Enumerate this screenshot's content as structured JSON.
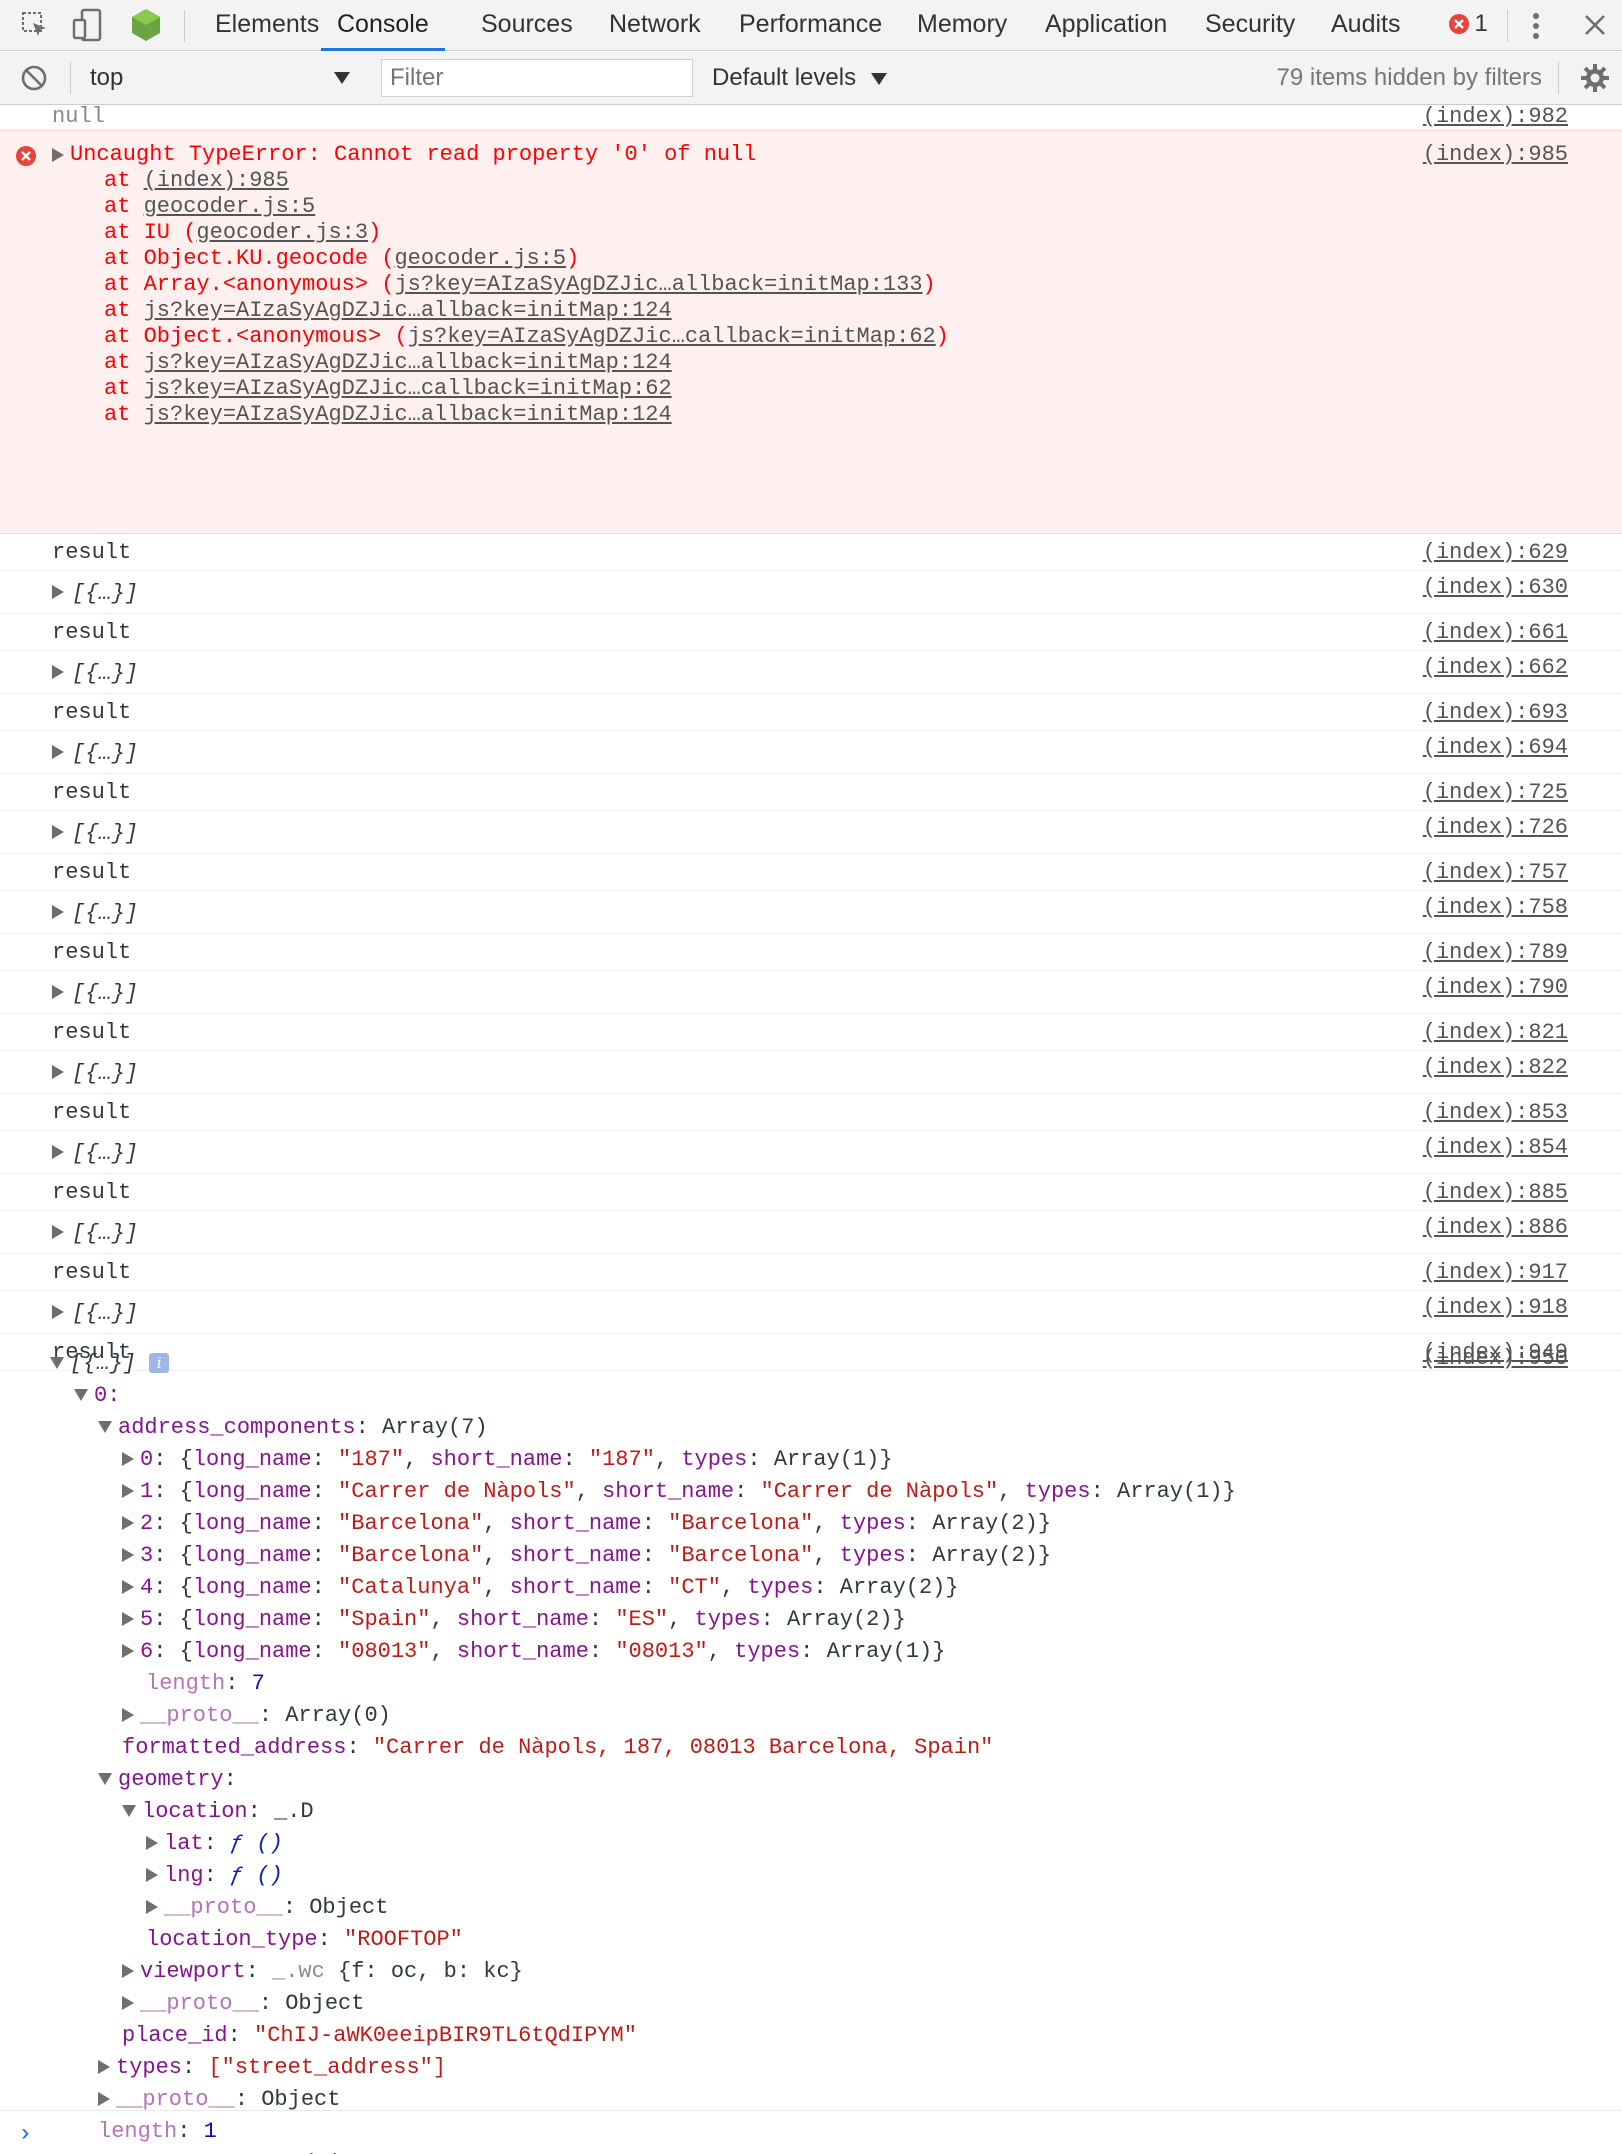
{
  "tabs": {
    "items": [
      "Elements",
      "Console",
      "Sources",
      "Network",
      "Performance",
      "Memory",
      "Application",
      "Security",
      "Audits"
    ],
    "active": "Console",
    "error_count": "1"
  },
  "toolbar": {
    "context": "top",
    "filter_placeholder": "Filter",
    "levels": "Default levels",
    "hidden": "79 items hidden by filters"
  },
  "console": {
    "top_partial": {
      "text": "null",
      "src": "(index):982"
    },
    "error": {
      "message": "Uncaught TypeError: Cannot read property '0' of null",
      "src": "(index):985",
      "stack": [
        {
          "prefix": "at ",
          "fn": "",
          "loc": "(index):985",
          "paren": false
        },
        {
          "prefix": "at ",
          "fn": "",
          "loc": "geocoder.js:5",
          "paren": false
        },
        {
          "prefix": "at ",
          "fn": "IU ",
          "loc": "geocoder.js:3",
          "paren": true
        },
        {
          "prefix": "at ",
          "fn": "Object.KU.geocode ",
          "loc": "geocoder.js:5",
          "paren": true
        },
        {
          "prefix": "at ",
          "fn": "Array.<anonymous> ",
          "loc": "js?key=AIzaSyAgDZJic…allback=initMap:133",
          "paren": true
        },
        {
          "prefix": "at ",
          "fn": "",
          "loc": "js?key=AIzaSyAgDZJic…allback=initMap:124",
          "paren": false
        },
        {
          "prefix": "at ",
          "fn": "Object.<anonymous> ",
          "loc": "js?key=AIzaSyAgDZJic…callback=initMap:62",
          "paren": true
        },
        {
          "prefix": "at ",
          "fn": "",
          "loc": "js?key=AIzaSyAgDZJic…allback=initMap:124",
          "paren": false
        },
        {
          "prefix": "at ",
          "fn": "",
          "loc": "js?key=AIzaSyAgDZJic…callback=initMap:62",
          "paren": false
        },
        {
          "prefix": "at ",
          "fn": "",
          "loc": "js?key=AIzaSyAgDZJic…allback=initMap:124",
          "paren": false
        }
      ]
    },
    "result_label": "result",
    "array_label": "[{…}]",
    "logs": [
      {
        "result_src": "(index):629",
        "array_src": "(index):630"
      },
      {
        "result_src": "(index):661",
        "array_src": "(index):662"
      },
      {
        "result_src": "(index):693",
        "array_src": "(index):694"
      },
      {
        "result_src": "(index):725",
        "array_src": "(index):726"
      },
      {
        "result_src": "(index):757",
        "array_src": "(index):758"
      },
      {
        "result_src": "(index):789",
        "array_src": "(index):790"
      },
      {
        "result_src": "(index):821",
        "array_src": "(index):822"
      },
      {
        "result_src": "(index):853",
        "array_src": "(index):854"
      },
      {
        "result_src": "(index):885",
        "array_src": "(index):886"
      },
      {
        "result_src": "(index):917",
        "array_src": "(index):918"
      },
      {
        "result_src": "(index):949",
        "array_src": "(index):950"
      }
    ],
    "expanded": {
      "root": "[{…}]",
      "index0": "0:",
      "address_components_key": "address_components",
      "address_components_val": "Array(7)",
      "components": [
        {
          "i": "0",
          "long_name": "\"187\"",
          "short_name": "\"187\"",
          "types": "Array(1)"
        },
        {
          "i": "1",
          "long_name": "\"Carrer de Nàpols\"",
          "short_name": "\"Carrer de Nàpols\"",
          "types": "Array(1)"
        },
        {
          "i": "2",
          "long_name": "\"Barcelona\"",
          "short_name": "\"Barcelona\"",
          "types": "Array(2)"
        },
        {
          "i": "3",
          "long_name": "\"Barcelona\"",
          "short_name": "\"Barcelona\"",
          "types": "Array(2)"
        },
        {
          "i": "4",
          "long_name": "\"Catalunya\"",
          "short_name": "\"CT\"",
          "types": "Array(2)"
        },
        {
          "i": "5",
          "long_name": "\"Spain\"",
          "short_name": "\"ES\"",
          "types": "Array(2)"
        },
        {
          "i": "6",
          "long_name": "\"08013\"",
          "short_name": "\"08013\"",
          "types": "Array(1)"
        }
      ],
      "components_length": "7",
      "proto_array0": "Array(0)",
      "formatted_address": "\"Carrer de Nàpols, 187, 08013 Barcelona, Spain\"",
      "location_val": "_.D",
      "lat": "ƒ ()",
      "lng": "ƒ ()",
      "proto_object": "Object",
      "location_type": "\"ROOFTOP\"",
      "viewport_class": "_.wc",
      "viewport_val": "{f: oc, b: kc}",
      "place_id": "\"ChIJ-aWK0eeipBIR9TL6tQdIPYM\"",
      "types": "[\"street_address\"]",
      "length": "1"
    }
  }
}
